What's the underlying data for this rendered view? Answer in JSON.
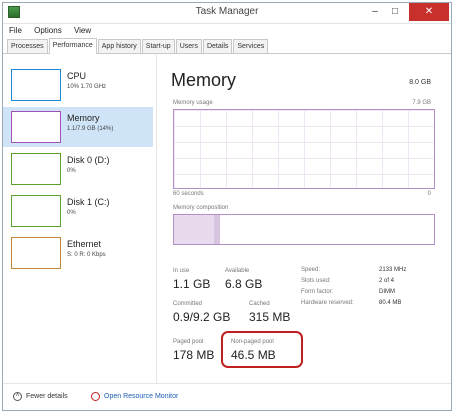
{
  "window": {
    "title": "Task Manager"
  },
  "window_buttons": {
    "minimize": "–",
    "maximize": "□",
    "close": "✕"
  },
  "menu": [
    "File",
    "Options",
    "View"
  ],
  "tabs": [
    "Processes",
    "Performance",
    "App history",
    "Start-up",
    "Users",
    "Details",
    "Services"
  ],
  "active_tab": "Performance",
  "sidebar": [
    {
      "name": "CPU",
      "sub": "10% 1.70 GHz",
      "color": "#1b87d6",
      "selected": false
    },
    {
      "name": "Memory",
      "sub": "1.1/7.9 GB (14%)",
      "color": "#a052b8",
      "selected": true
    },
    {
      "name": "Disk 0 (D:)",
      "sub": "0%",
      "color": "#5ea22e",
      "selected": false
    },
    {
      "name": "Disk 1 (C:)",
      "sub": "0%",
      "color": "#5ea22e",
      "selected": false
    },
    {
      "name": "Ethernet",
      "sub": "S: 0 R: 0 Kbps",
      "color": "#c8883a",
      "selected": false
    }
  ],
  "memory": {
    "title": "Memory",
    "total": "8.0 GB",
    "usage_label": "Memory usage",
    "usage_max": "7.9 GB",
    "graph_left": "60 seconds",
    "graph_right": "0",
    "composition_label": "Memory composition",
    "stats": {
      "in_use": {
        "label": "In use",
        "value": "1.1 GB"
      },
      "available": {
        "label": "Available",
        "value": "6.8 GB"
      },
      "committed": {
        "label": "Committed",
        "value": "0.9/9.2 GB"
      },
      "cached": {
        "label": "Cached",
        "value": "315 MB"
      },
      "paged_pool": {
        "label": "Paged pool",
        "value": "178 MB"
      },
      "non_paged_pool": {
        "label": "Non-paged pool",
        "value": "46.5 MB"
      }
    },
    "specs": [
      {
        "label": "Speed:",
        "value": "2133 MHz"
      },
      {
        "label": "Slots used:",
        "value": "2 of 4"
      },
      {
        "label": "Form factor:",
        "value": "DIMM"
      },
      {
        "label": "Hardware reserved:",
        "value": "80.4 MB"
      }
    ]
  },
  "footer": {
    "fewer_details": "Fewer details",
    "open_monitor": "Open Resource Monitor"
  },
  "colors": {
    "accent_memory": "#a052b8",
    "selection": "#cfe5f7",
    "highlight": "#c0201f"
  }
}
